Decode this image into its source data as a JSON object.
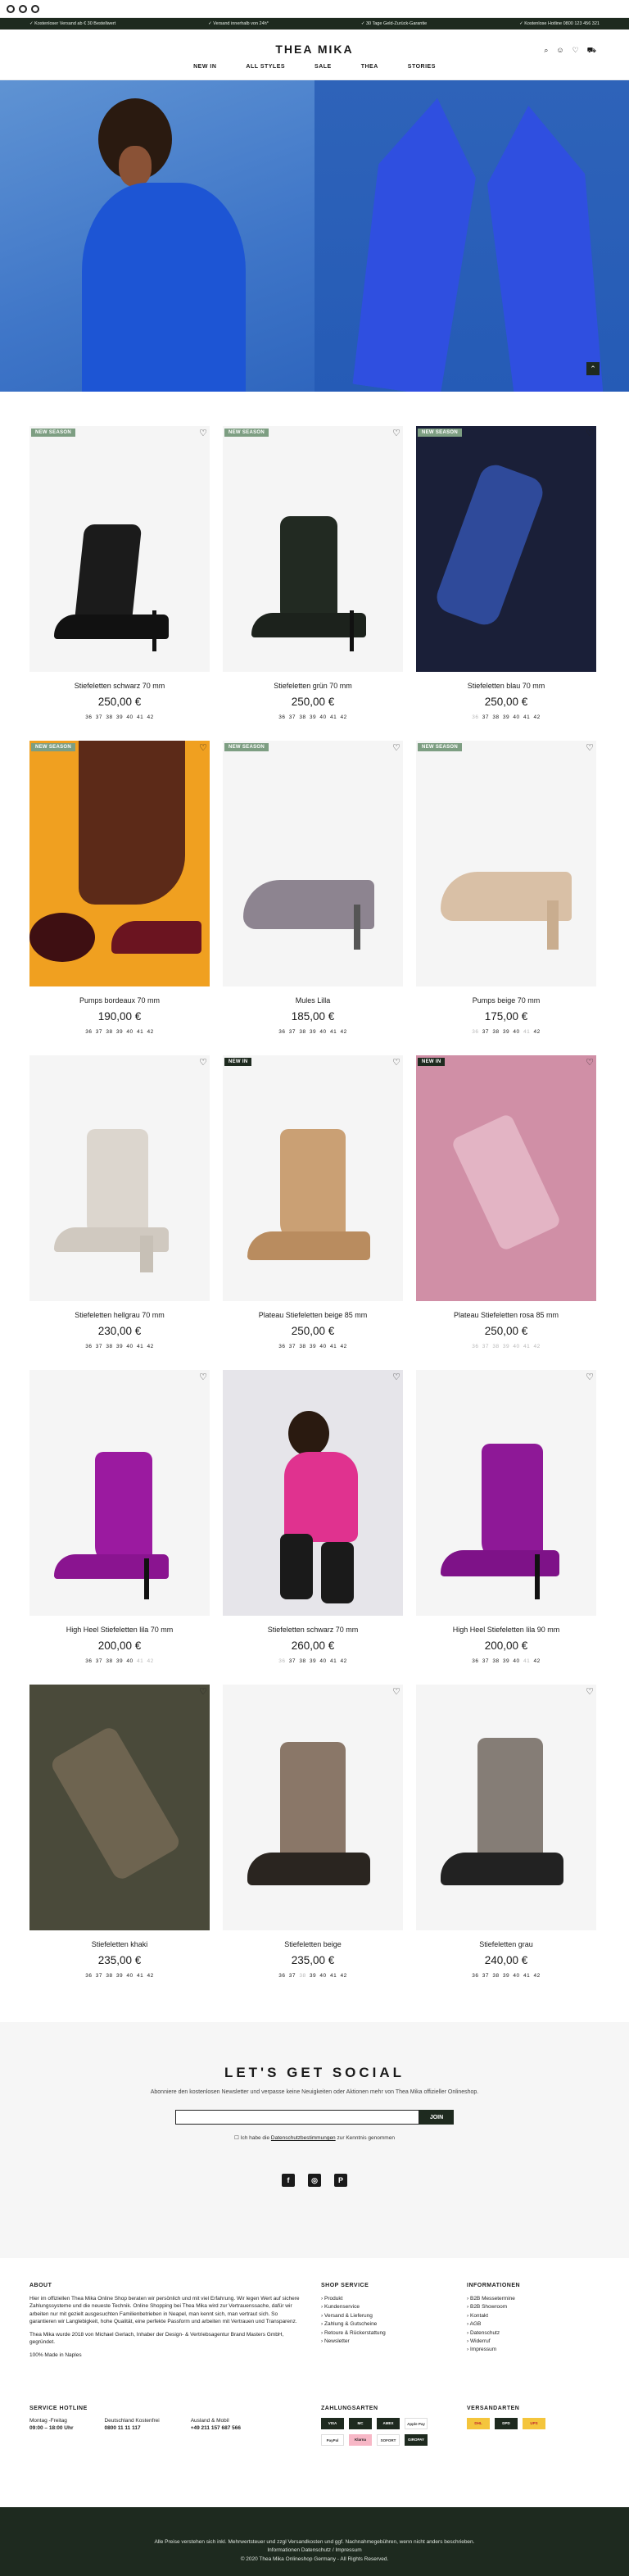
{
  "topbar": [
    "Kostenloser Versand ab € 30 Bestellwert",
    "Versand innerhalb von 24h*",
    "30 Tage Geld-Zurück-Garantie",
    "Kostenlose Hotline 0800 123 456 321"
  ],
  "header": {
    "logo": "THEA MIKA"
  },
  "nav": [
    "NEW IN",
    "ALL STYLES",
    "SALE",
    "THEA",
    "STORIES"
  ],
  "products": [
    {
      "name": "Stiefeletten schwarz 70 mm",
      "price": "250,00 €",
      "badge": "NEW SEASON",
      "sizes_available": [
        "36",
        "37",
        "38",
        "39",
        "40",
        "41",
        "42"
      ],
      "sizes_na": []
    },
    {
      "name": "Stiefeletten grün 70 mm",
      "price": "250,00 €",
      "badge": "NEW SEASON",
      "sizes_available": [
        "36",
        "37",
        "38",
        "39",
        "40",
        "41",
        "42"
      ],
      "sizes_na": []
    },
    {
      "name": "Stiefeletten blau 70 mm",
      "price": "250,00 €",
      "badge": "NEW SEASON",
      "sizes_available": [
        "37",
        "38",
        "39",
        "40",
        "41",
        "42"
      ],
      "sizes_na": [
        "36"
      ]
    },
    {
      "name": "Pumps bordeaux 70 mm",
      "price": "190,00 €",
      "badge": "NEW SEASON",
      "sizes_available": [
        "36",
        "37",
        "38",
        "39",
        "40",
        "41",
        "42"
      ],
      "sizes_na": []
    },
    {
      "name": "Mules Lilla",
      "price": "185,00 €",
      "badge": "NEW SEASON",
      "sizes_available": [
        "36",
        "37",
        "38",
        "39",
        "40",
        "41",
        "42"
      ],
      "sizes_na": []
    },
    {
      "name": "Pumps beige 70 mm",
      "price": "175,00 €",
      "badge": "NEW SEASON",
      "sizes_available": [
        "37",
        "38",
        "39",
        "40",
        "42"
      ],
      "sizes_na": [
        "36",
        "41"
      ]
    },
    {
      "name": "Stiefeletten hellgrau 70 mm",
      "price": "230,00 €",
      "badge": "",
      "sizes_available": [
        "36",
        "37",
        "38",
        "39",
        "40",
        "41",
        "42"
      ],
      "sizes_na": []
    },
    {
      "name": "Plateau Stiefeletten beige 85 mm",
      "price": "250,00 €",
      "badge": "NEW IN",
      "sizes_available": [
        "36",
        "37",
        "38",
        "39",
        "40",
        "41",
        "42"
      ],
      "sizes_na": []
    },
    {
      "name": "Plateau Stiefeletten rosa 85 mm",
      "price": "250,00 €",
      "badge": "NEW IN",
      "sizes_available": [],
      "sizes_na": [
        "36",
        "37",
        "38",
        "39",
        "40",
        "41",
        "42"
      ]
    },
    {
      "name": "High Heel Stiefeletten lila 70 mm",
      "price": "200,00 €",
      "badge": "",
      "sizes_available": [
        "36",
        "37",
        "38",
        "39",
        "40"
      ],
      "sizes_na": [
        "41",
        "42"
      ]
    },
    {
      "name": "Stiefeletten schwarz 70 mm",
      "price": "260,00 €",
      "badge": "",
      "sizes_available": [
        "37",
        "38",
        "39",
        "40",
        "41",
        "42"
      ],
      "sizes_na": [
        "36"
      ]
    },
    {
      "name": "High Heel Stiefeletten lila 90 mm",
      "price": "200,00 €",
      "badge": "",
      "sizes_available": [
        "36",
        "37",
        "38",
        "39",
        "40",
        "42"
      ],
      "sizes_na": [
        "41"
      ]
    },
    {
      "name": "Stiefeletten khaki",
      "price": "235,00 €",
      "badge": "",
      "sizes_available": [
        "36",
        "37",
        "38",
        "39",
        "40",
        "41",
        "42"
      ],
      "sizes_na": []
    },
    {
      "name": "Stiefeletten beige",
      "price": "235,00 €",
      "badge": "",
      "sizes_available": [
        "36",
        "37",
        "39",
        "40",
        "41",
        "42"
      ],
      "sizes_na": [
        "38"
      ]
    },
    {
      "name": "Stiefeletten grau",
      "price": "240,00 €",
      "badge": "",
      "sizes_available": [
        "36",
        "37",
        "38",
        "39",
        "40",
        "41",
        "42"
      ],
      "sizes_na": []
    }
  ],
  "social": {
    "title": "LET'S GET SOCIAL",
    "text": "Abonniere den kostenlosen Newsletter und verpasse keine Neuigkeiten oder Aktionen mehr von Thea Mika offizieller Onlineshop.",
    "placeholder": "",
    "button": "JOIN",
    "consent_pre": "Ich habe die",
    "consent_link": "Datenschutzbestimmungen",
    "consent_post": "zur Kenntnis genommen",
    "icons": [
      "facebook-icon",
      "instagram-icon",
      "pinterest-icon"
    ]
  },
  "footer": {
    "about_title": "ABOUT",
    "about_p1": "Hier im offiziellen Thea Mika Online Shop beraten wir persönlich und mit viel Erfahrung. Wir legen Wert auf sichere Zahlungssysteme und die neueste Technik. Online Shopping bei Thea Mika wird zur Vertrauenssache, dafür wir arbeiten nur mit gezielt ausgesuchten Familienbetrieben in Neapel, man kennt sich, man vertraut sich. So garantieren wir Langlebigkeit, hohe Qualität, eine perfekte Passform und arbeiten mit Vertrauen und Transparenz.",
    "about_p2": "Thea Mika wurde 2018 von Michael Gerlach, Inhaber der Design- & Vertriebsagentur Brand Masters GmbH, gegründet.",
    "about_p3": "100% Made in Naples",
    "shop_title": "SHOP SERVICE",
    "shop_items": [
      "Produkt",
      "Kundenservice",
      "Versand & Lieferung",
      "Zahlung & Gutscheine",
      "Retoure & Rückerstattung",
      "Newsletter"
    ],
    "info_title": "INFORMATIONEN",
    "info_items": [
      "B2B Messetermine",
      "B2B Showroom",
      "Kontakt",
      "AGB",
      "Datenschutz",
      "Widerruf",
      "Impressum"
    ],
    "hotline_title": "SERVICE HOTLINE",
    "hours_label": "Montag -Freitag",
    "hours_value": "09:00 – 18:00 Uhr",
    "de_label": "Deutschland Kostenfrei",
    "de_value": "0800 11 11 117",
    "int_label": "Ausland & Mobil",
    "int_value": "+49 211 157 687 566",
    "pay_title": "ZAHLUNGSARTEN",
    "pay_logos": [
      "VISA",
      "MC",
      "AMEX",
      "Apple Pay",
      "PayPal",
      "Klarna",
      "SOFORT",
      "GIROPAY"
    ],
    "ship_title": "VERSANDARTEN",
    "ship_logos": [
      "DHL",
      "DPD",
      "UPS"
    ]
  },
  "bottom": {
    "l1": "Alle Preise verstehen sich inkl. Mehrwertsteuer und zzgl Versandkosten und ggf. Nachnahmegebühren, wenn nicht anders beschrieben.",
    "l2": "Informationen Datenschutz / Impressum",
    "l3": "© 2020 Thea Mika Onlineshop Germany - All Rights Reserved."
  }
}
